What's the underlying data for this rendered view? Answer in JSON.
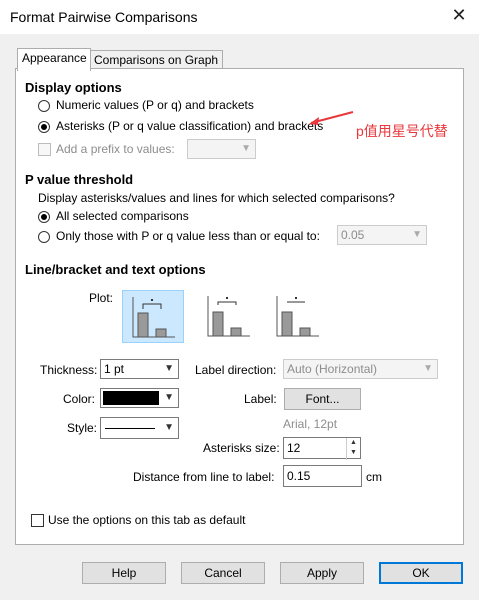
{
  "window": {
    "title": "Format Pairwise Comparisons",
    "close_glyph": "✕"
  },
  "tabs": [
    {
      "label": "Appearance"
    },
    {
      "label": "Comparisons on Graph"
    }
  ],
  "display_options": {
    "heading": "Display options",
    "numeric_label": "Numeric values (P or q) and brackets",
    "asterisks_label": "Asterisks (P or q value classification) and brackets",
    "prefix_label": "Add a prefix to values:",
    "prefix_value": ""
  },
  "annotation": {
    "text": "p值用星号代替",
    "color": "#e8383d"
  },
  "p_threshold": {
    "heading": "P value threshold",
    "question": "Display asterisks/values and lines for which selected comparisons?",
    "all_label": "All selected comparisons",
    "only_label": "Only those with P or q value less than or equal to:",
    "threshold_value": "0.05"
  },
  "line_options": {
    "heading": "Line/bracket and text options",
    "plot_label": "Plot:",
    "thickness_label": "Thickness:",
    "thickness_value": "1 pt",
    "color_label": "Color:",
    "color_value": "#000000",
    "style_label": "Style:",
    "label_direction_label": "Label direction:",
    "label_direction_value": "Auto (Horizontal)",
    "label_label": "Label:",
    "font_button": "Font...",
    "font_desc": "Arial, 12pt",
    "asterisks_size_label": "Asterisks size:",
    "asterisks_size_value": "12",
    "distance_label": "Distance from line to label:",
    "distance_value": "0.15",
    "distance_unit": "cm"
  },
  "default_checkbox_label": "Use the options on this tab as default",
  "buttons": {
    "help": "Help",
    "cancel": "Cancel",
    "apply": "Apply",
    "ok": "OK"
  }
}
